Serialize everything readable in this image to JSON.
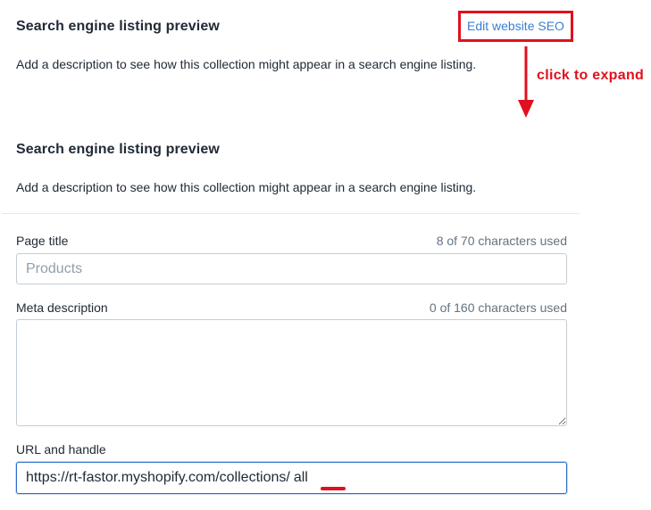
{
  "top_section": {
    "heading": "Search engine listing preview",
    "edit_link": "Edit website SEO",
    "description": "Add a description to see how this collection might appear in a search engine listing."
  },
  "annotation": {
    "text": "click to expand",
    "color": "#e0101e"
  },
  "expanded_section": {
    "heading": "Search engine listing preview",
    "description": "Add a description to see how this collection might appear in a search engine listing.",
    "page_title": {
      "label": "Page title",
      "counter": "8 of 70 characters used",
      "placeholder": "Products",
      "value": ""
    },
    "meta_description": {
      "label": "Meta description",
      "counter": "0 of 160 characters used",
      "value": ""
    },
    "url_handle": {
      "label": "URL and handle",
      "prefix": "https://rt-fastor.myshopify.com/collections/",
      "handle": "all"
    }
  },
  "colors": {
    "accent_link": "#3a7fd5",
    "highlight_red": "#e0101e",
    "focus_border": "#2c6ecb"
  }
}
